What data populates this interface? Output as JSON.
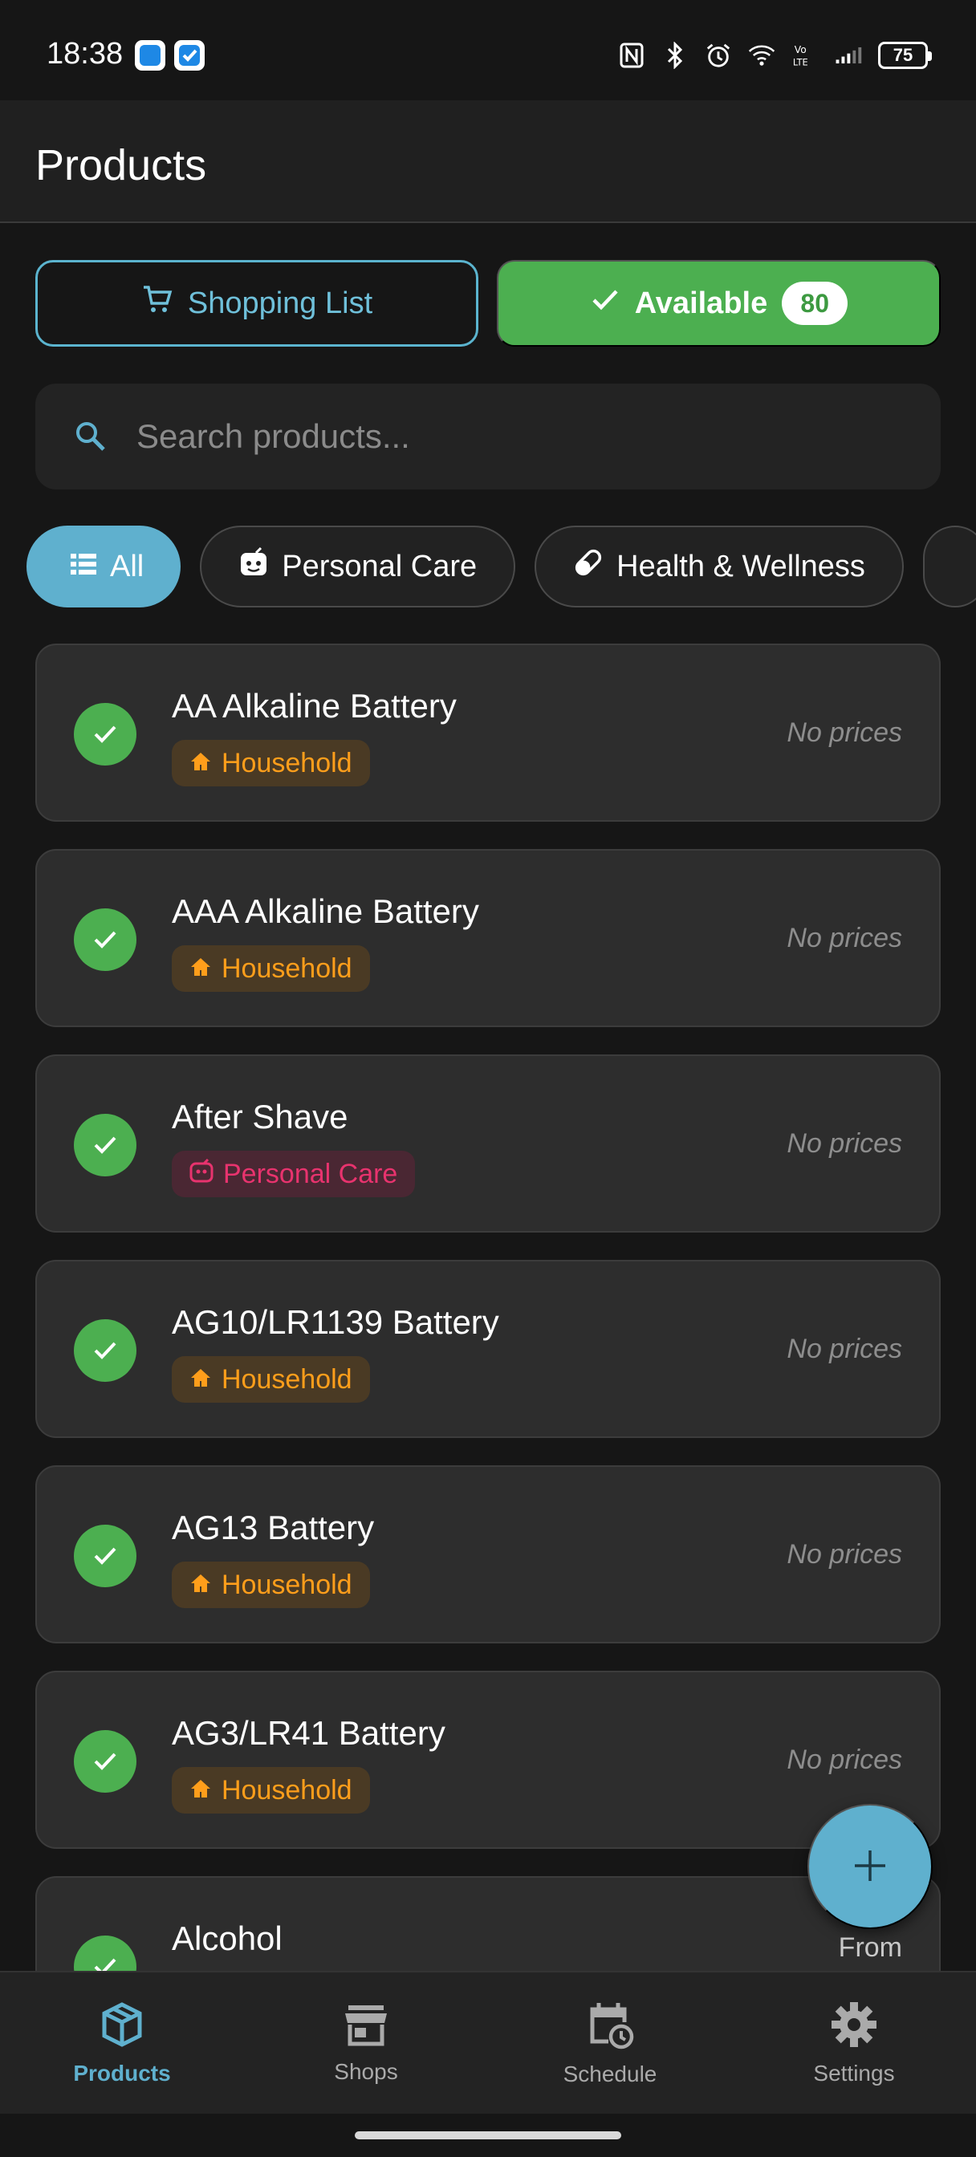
{
  "status_bar": {
    "time": "18:38",
    "battery": "75",
    "icons": [
      "nfc-icon",
      "bluetooth-icon",
      "alarm-icon",
      "wifi-icon",
      "volte-icon",
      "signal-icon"
    ]
  },
  "header": {
    "title": "Products"
  },
  "toggle": {
    "shopping_label": "Shopping List",
    "available_label": "Available",
    "available_count": "80"
  },
  "search": {
    "placeholder": "Search products..."
  },
  "categories": [
    {
      "label": "All",
      "icon": "list-icon",
      "active": true
    },
    {
      "label": "Personal Care",
      "icon": "face-icon",
      "active": false
    },
    {
      "label": "Health & Wellness",
      "icon": "pill-icon",
      "active": false
    }
  ],
  "products": [
    {
      "name": "AA Alkaline Battery",
      "category": "Household",
      "price": "No prices"
    },
    {
      "name": "AAA Alkaline Battery",
      "category": "Household",
      "price": "No prices"
    },
    {
      "name": "After Shave",
      "category": "Personal Care",
      "price": "No prices"
    },
    {
      "name": "AG10/LR1139 Battery",
      "category": "Household",
      "price": "No prices"
    },
    {
      "name": "AG13 Battery",
      "category": "Household",
      "price": "No prices"
    },
    {
      "name": "AG3/LR41 Battery",
      "category": "Household",
      "price": "No prices"
    },
    {
      "name": "Alcohol",
      "price_from_label": "From"
    }
  ],
  "bottom_nav": [
    {
      "label": "Products",
      "icon": "package-icon",
      "active": true
    },
    {
      "label": "Shops",
      "icon": "store-icon",
      "active": false
    },
    {
      "label": "Schedule",
      "icon": "calendar-clock-icon",
      "active": false
    },
    {
      "label": "Settings",
      "icon": "gear-icon",
      "active": false
    }
  ],
  "colors": {
    "accent": "#5fb0ce",
    "success": "#4caf50",
    "household": "#ff9e1b",
    "personal_care": "#e8336e"
  }
}
